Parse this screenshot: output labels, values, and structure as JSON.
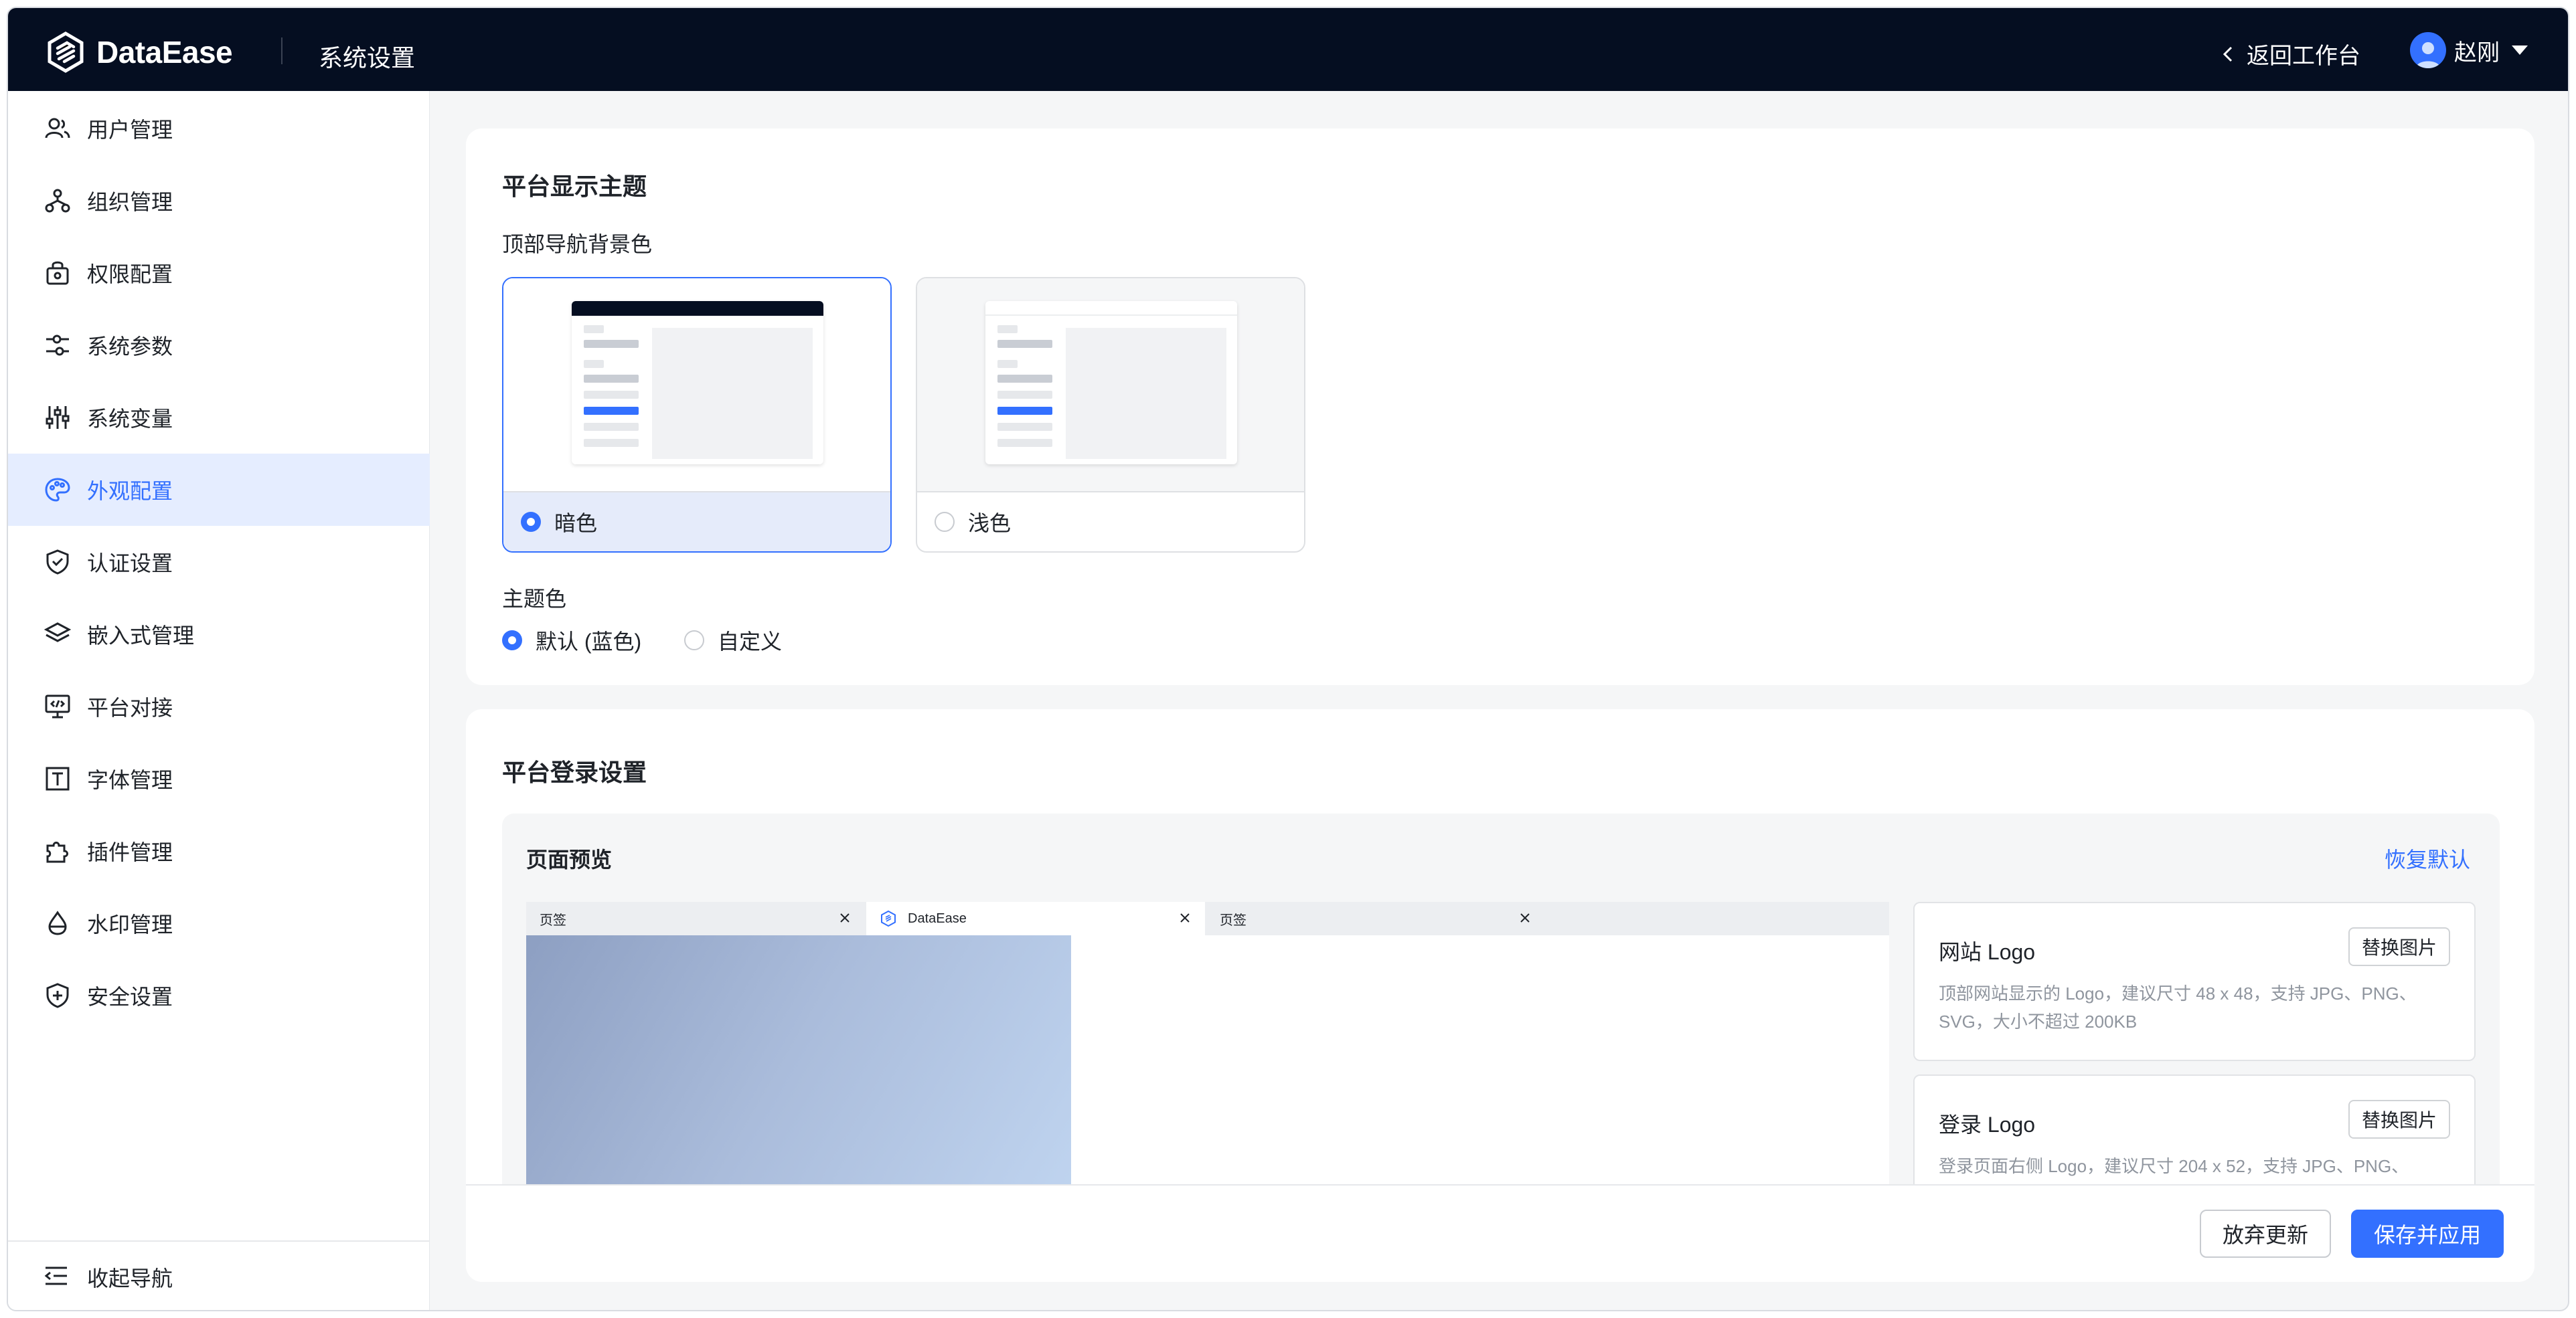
{
  "app": {
    "name": "DataEase",
    "section_title": "系统设置"
  },
  "header": {
    "back_label": "返回工作台",
    "user_name": "赵刚"
  },
  "sidebar": {
    "items": [
      {
        "label": "用户管理",
        "icon": "users-icon"
      },
      {
        "label": "组织管理",
        "icon": "org-tree-icon"
      },
      {
        "label": "权限配置",
        "icon": "lock-bag-icon"
      },
      {
        "label": "系统参数",
        "icon": "sliders-icon"
      },
      {
        "label": "系统变量",
        "icon": "variables-icon"
      },
      {
        "label": "外观配置",
        "icon": "palette-icon",
        "active": true
      },
      {
        "label": "认证设置",
        "icon": "shield-check-icon"
      },
      {
        "label": "嵌入式管理",
        "icon": "layers-icon"
      },
      {
        "label": "平台对接",
        "icon": "monitor-code-icon"
      },
      {
        "label": "字体管理",
        "icon": "font-icon"
      },
      {
        "label": "插件管理",
        "icon": "puzzle-icon"
      },
      {
        "label": "水印管理",
        "icon": "drop-icon"
      },
      {
        "label": "安全设置",
        "icon": "shield-plus-icon"
      }
    ],
    "collapse_label": "收起导航"
  },
  "theme": {
    "title": "平台显示主题",
    "nav_bg_label": "顶部导航背景色",
    "options": [
      {
        "label": "暗色",
        "selected": true
      },
      {
        "label": "浅色",
        "selected": false
      }
    ],
    "color_label": "主题色",
    "color_options": [
      {
        "label": "默认 (蓝色)",
        "selected": true
      },
      {
        "label": "自定义",
        "selected": false
      }
    ]
  },
  "login": {
    "title": "平台登录设置",
    "preview_label": "页面预览",
    "restore_label": "恢复默认",
    "tabs": [
      "页签",
      "DataEase",
      "页签"
    ],
    "assets": [
      {
        "title": "网站 Logo",
        "button": "替换图片",
        "desc": "顶部网站显示的 Logo，建议尺寸 48 x 48，支持 JPG、PNG、SVG，大小不超过 200KB"
      },
      {
        "title": "登录 Logo",
        "button": "替换图片",
        "desc": "登录页面右侧 Logo，建议尺寸 204 x 52，支持 JPG、PNG、"
      }
    ]
  },
  "footer": {
    "discard_label": "放弃更新",
    "save_label": "保存并应用"
  },
  "colors": {
    "topbar": "#050e21",
    "accent": "#3370ff",
    "active_bg": "#e5edff"
  }
}
